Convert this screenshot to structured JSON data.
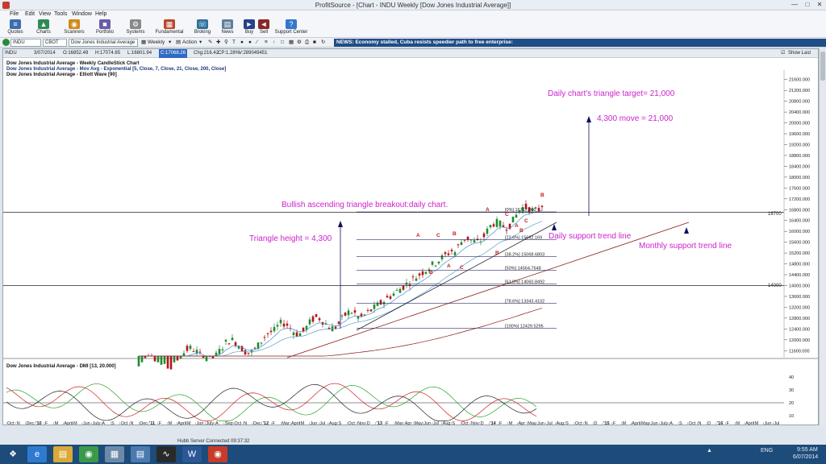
{
  "window": {
    "title": "ProfitSource - [Chart - INDU Weekly [Dow Jones Industrial Average]]"
  },
  "menu": [
    "File",
    "Edit",
    "View",
    "Tools",
    "Window",
    "Help"
  ],
  "toolbar": [
    "Quotes",
    "Charts",
    "Scanners",
    "Portfolio",
    "Systems",
    "Fundamental",
    "Broking",
    "News",
    "Buy",
    "Sell",
    "Support Center"
  ],
  "symbolbar": {
    "symbol": "INDU",
    "exchange": "CBOT",
    "name": "Dow Jones Industrial Average",
    "period": "Weekly",
    "action": "Action",
    "news": "NEWS: Economy stalled, Cuba resists speedier path to free enterprise:"
  },
  "quote": {
    "symbol": "INDU",
    "date": "3/07/2014",
    "open": "O:16852.49",
    "high": "H:17074.65",
    "low": "L:16801.94",
    "close": "C:17068.26",
    "change": "Chg:216.42",
    "change_pct": "CP:1.28%",
    "volume": "V:289049451",
    "show_last": "Show Last"
  },
  "legend": {
    "line1": "Dow Jones Industrial Average - Weekly CandleStick Chart",
    "line2": "Dow Jones Industrial Average - Mov Avg - Exponential [5, Close, 7, Close, 21, Close, 200, Close]",
    "line3": "Dow Jones Industrial Average - Elliott Wave [90]"
  },
  "annotations": {
    "triangle_target": "Daily chart's triangle target= 21,000",
    "move": "4,300 move = 21,000",
    "breakout": "Bullish ascending triangle breakout:daily chart.",
    "height": "Triangle height = 4,300",
    "daily_support": "Daily support trend line",
    "monthly_support": "Monthly support trend line",
    "hline_upper": "16700",
    "hline_lower": "14000"
  },
  "fibs": [
    {
      "label": "[0%] 16717.000",
      "value": 16717
    },
    {
      "label": "[23.6%] 15692.169",
      "value": 15692
    },
    {
      "label": "[38.2%] 15068.6803",
      "value": 15069
    },
    {
      "label": "[50%] 14564.7648",
      "value": 14565
    },
    {
      "label": "[61.8%] 14060.8492",
      "value": 14061
    },
    {
      "label": "[78.6%] 13343.4102",
      "value": 13343
    },
    {
      "label": "[100%] 12429.5295",
      "value": 12430
    }
  ],
  "waves": [
    "A",
    "B",
    "C",
    "A",
    "B",
    "C",
    "A",
    "B",
    "C",
    "A",
    "B",
    "C",
    "B"
  ],
  "dmi": {
    "title": "Dow Jones Industrial Average - DMI [13, 20.000]",
    "ticks": [
      "40",
      "30",
      "20",
      "10"
    ]
  },
  "price_ticks": [
    "21600.000",
    "21200.000",
    "20800.000",
    "20400.000",
    "20000.000",
    "19600.000",
    "19200.000",
    "18800.000",
    "18400.000",
    "18000.000",
    "17600.000",
    "17200.000",
    "16800.000",
    "16400.000",
    "16000.000",
    "15600.000",
    "15200.000",
    "14800.000",
    "14400.000",
    "14000.000",
    "13600.000",
    "13200.000",
    "12800.000",
    "12400.000",
    "12000.000",
    "11600.000"
  ],
  "time_axis": [
    "Oct",
    "N",
    "Dec",
    "'10",
    "F",
    "M",
    "April",
    "M",
    "Jun",
    "July",
    "A",
    "S",
    "Oct",
    "N",
    "Dec",
    "'11",
    "F",
    "M",
    "April",
    "M",
    "Jun",
    "July",
    "A",
    "Sep",
    "Oct",
    "N",
    "Dec",
    "'12",
    "F",
    "Mar",
    "April",
    "M",
    "Jun",
    "Jul",
    "Aug",
    "S",
    "Oct",
    "Nov",
    "D",
    "'13",
    "F",
    "Mar",
    "Apr",
    "May",
    "Jun",
    "Jul",
    "Aug",
    "S",
    "Oct",
    "Nov",
    "D",
    "'14",
    "F",
    "M",
    "Apr",
    "May",
    "Jun",
    "Jul",
    "Aug",
    "S",
    "Oct",
    "N",
    "D",
    "'15",
    "F",
    "M",
    "April",
    "May",
    "Jun",
    "July",
    "A",
    "S",
    "Oct",
    "N",
    "D",
    "'16",
    "F",
    "M",
    "April",
    "M",
    "Jun",
    "Jul"
  ],
  "status": {
    "server": "Hubb Server Connected 09:37:32"
  },
  "taskbar": {
    "time": "9:55 AM",
    "date": "6/07/2014",
    "lang": "ENG"
  },
  "colors": {
    "candle_up": "#1f8a2e",
    "candle_down": "#b3141c",
    "annotation": "#cc22cc",
    "arrow": "#101060",
    "ema_short": "#5aa0c8",
    "ema_long": "#8a1a1a"
  },
  "chart_data": {
    "type": "candlestick",
    "ylim": [
      11400,
      21800
    ],
    "annotation_levels": {
      "upper_line": 16700,
      "lower_line": 14000,
      "target": 21000
    }
  }
}
